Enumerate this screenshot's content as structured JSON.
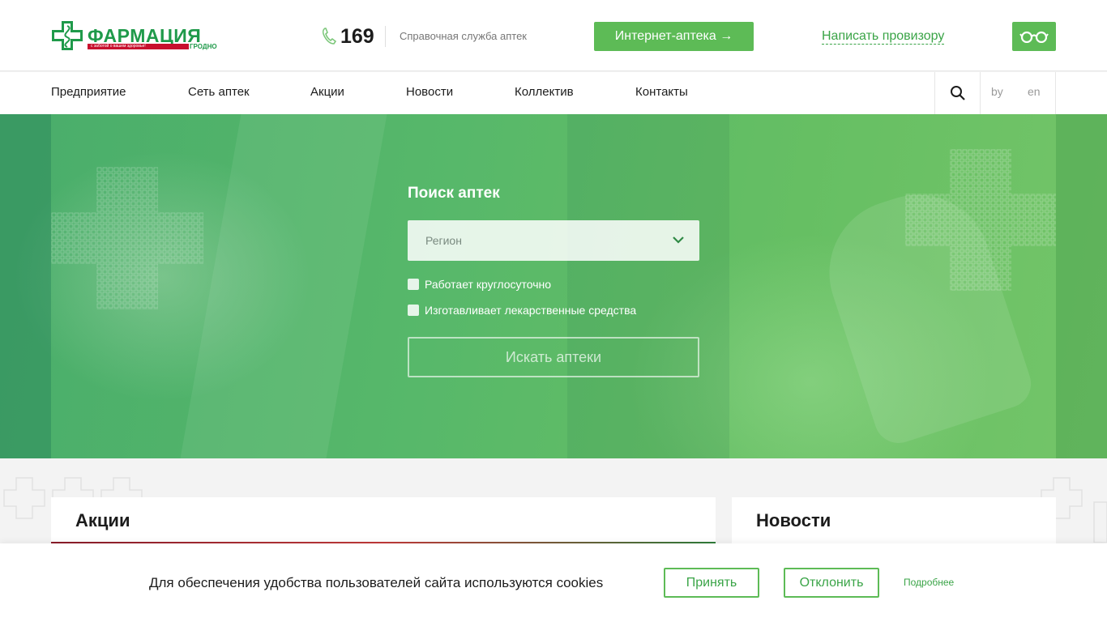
{
  "header": {
    "logo": {
      "name": "ФАРМАЦИЯ",
      "slogan": "с заботой о вашем здоровье!",
      "city": "ГРОДНО",
      "brand_color": "#1f9a4a",
      "accent_color": "#c8102e"
    },
    "phone": {
      "icon": "phone-icon",
      "number": "169",
      "description": "Справочная служба аптек"
    },
    "online_pharmacy_label": "Интернет-аптека →",
    "write_pharmacist_label": "Написать провизору",
    "low_vision_icon": "glasses-icon"
  },
  "nav": {
    "items": [
      {
        "label": "Предприятие"
      },
      {
        "label": "Сеть аптек"
      },
      {
        "label": "Акции"
      },
      {
        "label": "Новости"
      },
      {
        "label": "Коллектив"
      },
      {
        "label": "Контакты"
      }
    ],
    "search_icon": "search-icon",
    "languages": [
      "by",
      "en"
    ]
  },
  "hero": {
    "title": "Поиск аптек",
    "region_placeholder": "Регион",
    "checkboxes": [
      {
        "label": "Работает круглосуточно",
        "checked": false
      },
      {
        "label": "Изготавливает лекарственные средства",
        "checked": false
      }
    ],
    "search_button_label": "Искать аптеки"
  },
  "sections": {
    "promotions_title": "Акции",
    "news_title": "Новости"
  },
  "cookie": {
    "text": "Для обеспечения удобства пользователей сайта используются cookies",
    "accept_label": "Принять",
    "decline_label": "Отклонить",
    "more_label": "Подробнее"
  },
  "colors": {
    "accent": "#5dbb56",
    "link": "#3aa447"
  }
}
